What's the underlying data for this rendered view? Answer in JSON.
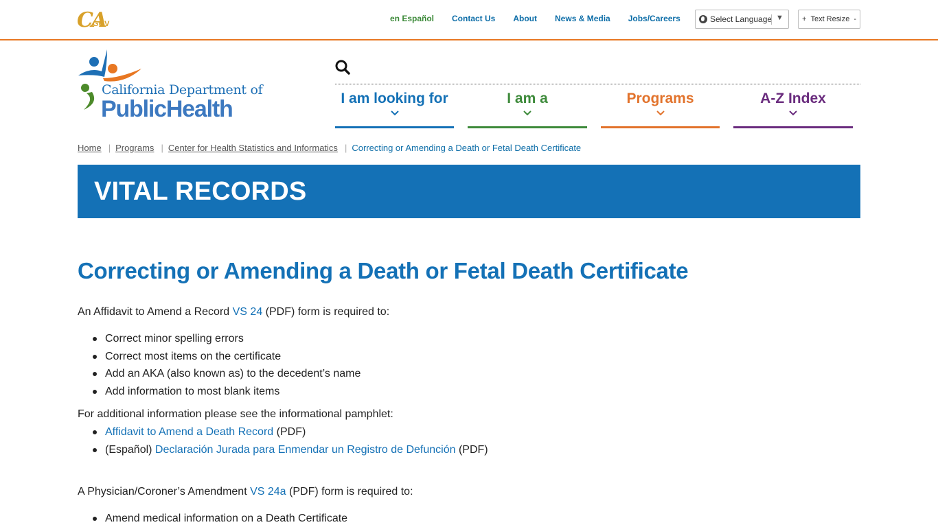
{
  "utility": {
    "ca_logo_text": "CA",
    "ca_logo_gov": ".GOV",
    "links": {
      "espanol": "en Español",
      "contact": "Contact Us",
      "about": "About",
      "news": "News & Media",
      "jobs": "Jobs/Careers"
    },
    "language_select": "Select Language",
    "text_resize_plus": "+",
    "text_resize": "Text Resize",
    "text_resize_minus": "-"
  },
  "logo": {
    "line1": "California Department of",
    "line2": "PublicHealth"
  },
  "nav": [
    {
      "label": "I am looking for",
      "color": "#1471b6"
    },
    {
      "label": "I am a",
      "color": "#3d8a3a"
    },
    {
      "label": "Programs",
      "color": "#e2732c"
    },
    {
      "label": "A-Z Index",
      "color": "#6a2c7e"
    }
  ],
  "breadcrumb": {
    "home": "Home",
    "programs": "Programs",
    "chsi": "Center for Health Statistics and Informatics",
    "current": "Correcting or Amending a Death or Fetal Death Certificate"
  },
  "banner_title": "VITAL RECORDS",
  "page_title": "Correcting or Amending a Death or Fetal Death Certificate",
  "section1": {
    "intro_before": "An Affidavit to Amend a Record ",
    "intro_link": "VS 24",
    "intro_after": " (PDF) form is required to:",
    "items": [
      "Correct minor spelling errors",
      "Correct most items on the certificate",
      "Add an AKA (also known as) to the decedent’s name",
      "Add information to most blank items"
    ]
  },
  "section2": {
    "intro": "For additional information please see the informational pamphlet:",
    "item1_link": "Affidavit to Amend a Death Record",
    "item1_suffix": " (PDF)",
    "item2_prefix": "(Español) ",
    "item2_link": "Declaración Jurada para Enmendar un Registro de Defunción",
    "item2_suffix": " (PDF)"
  },
  "section3": {
    "intro_before": "A Physician/Coroner’s Amendment ",
    "intro_link": "VS 24a",
    "intro_after": " (PDF) form is required to:",
    "items": [
      "Amend medical information on a Death Certificate"
    ]
  },
  "colors": {
    "accent_blue": "#1471b6",
    "accent_orange": "#e87722",
    "accent_green": "#3d8a3a",
    "accent_purple": "#6a2c7e"
  }
}
